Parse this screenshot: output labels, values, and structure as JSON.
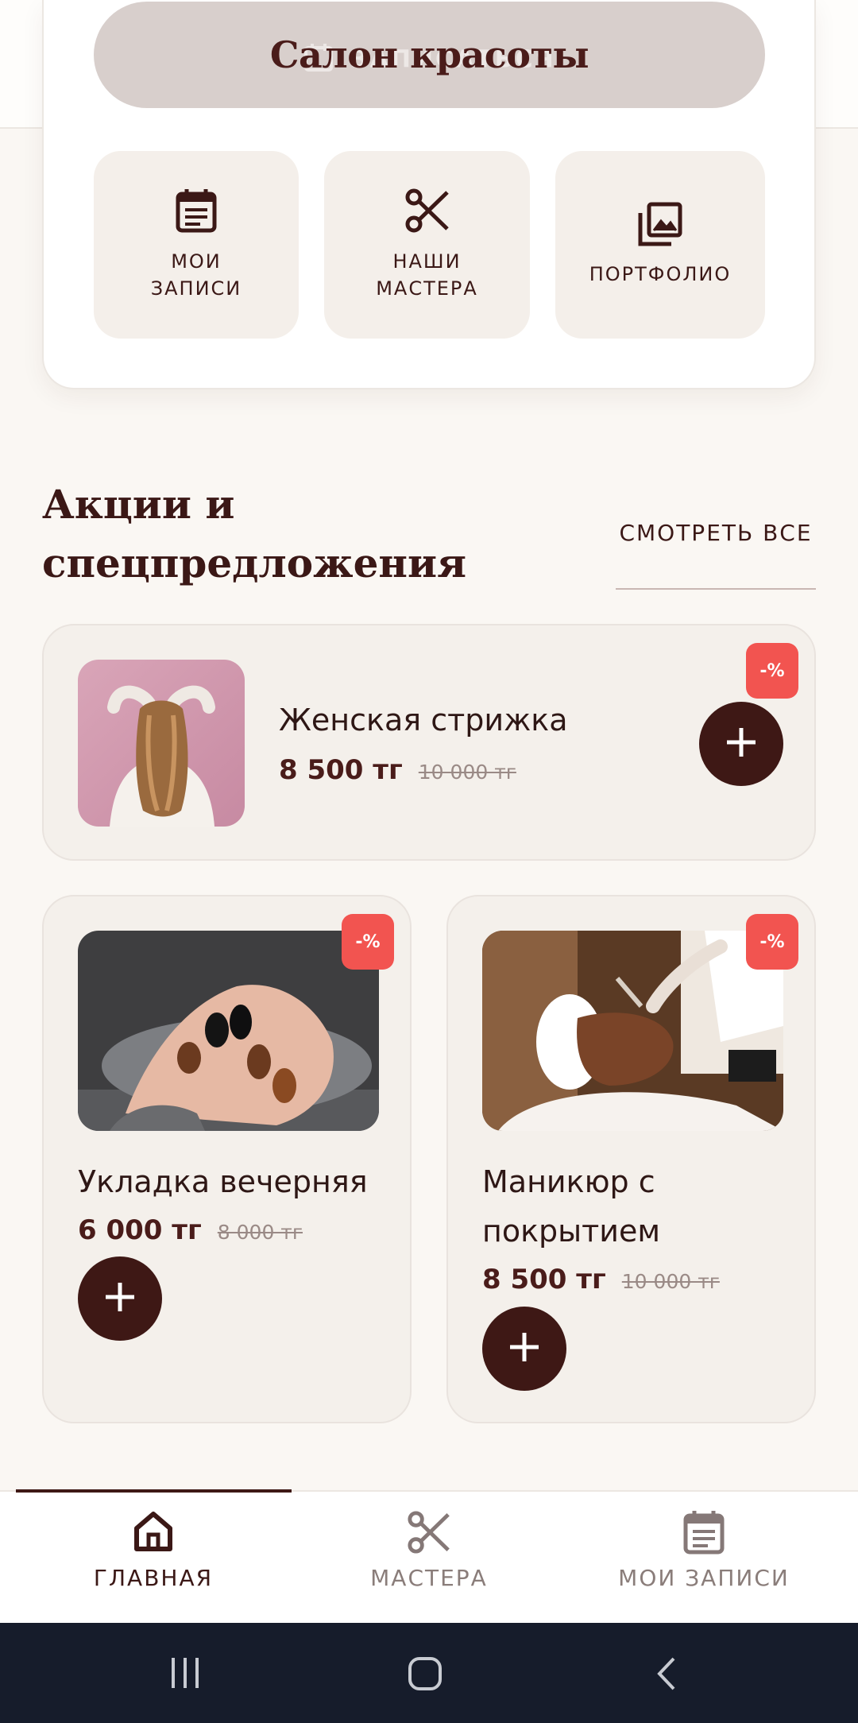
{
  "header": {
    "book_button_label": "ЗАПИСАТЬСЯ",
    "app_title": "Салон красоты"
  },
  "quick_actions": [
    {
      "label": "МОИ\nЗАПИСИ",
      "icon": "calendar-icon"
    },
    {
      "label": "НАШИ\nМАСТЕРА",
      "icon": "scissors-icon"
    },
    {
      "label": "ПОРТФОЛИО",
      "icon": "gallery-icon"
    }
  ],
  "promotions": {
    "title": "Акции и спецпредложения",
    "see_all_label": "СМОТРЕТЬ ВСЕ",
    "items": [
      {
        "name": "Женская стрижка",
        "price": "8 500 тг",
        "old_price": "10 000 тг",
        "badge": "-%",
        "image": "woman-long-hair-photo"
      },
      {
        "name": "Укладка вечерняя",
        "price": "6 000 тг",
        "old_price": "8 000 тг",
        "badge": "-%",
        "image": "manicured-nails-photo"
      },
      {
        "name": "Маникюр с покрытием",
        "price": "8 500 тг",
        "old_price": "10 000 тг",
        "badge": "-%",
        "image": "facial-mask-photo"
      }
    ]
  },
  "bottom_nav": [
    {
      "label": "ГЛАВНАЯ",
      "icon": "home-icon",
      "active": true
    },
    {
      "label": "МАСТЕРА",
      "icon": "scissors-icon",
      "active": false
    },
    {
      "label": "МОИ ЗАПИСИ",
      "icon": "calendar-icon",
      "active": false
    }
  ],
  "system_nav": [
    "recent-apps-icon",
    "home-circle-icon",
    "back-icon"
  ],
  "colors": {
    "accent": "#3e1815",
    "badge": "#f25450",
    "card_bg": "#f4f0eb",
    "page_bg": "#faf7f3"
  }
}
